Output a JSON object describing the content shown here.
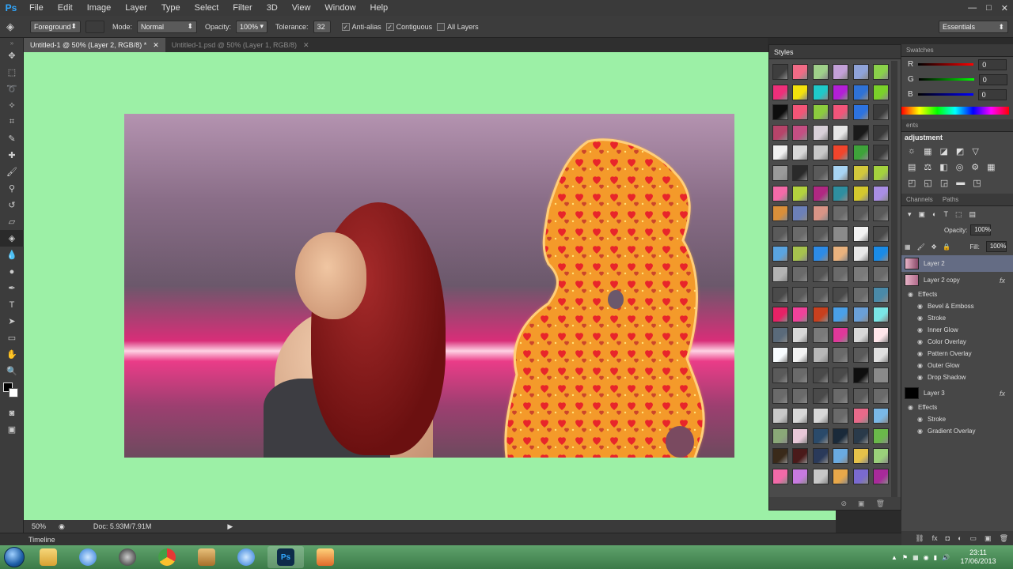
{
  "app": {
    "logo": "Ps"
  },
  "menu": [
    "File",
    "Edit",
    "Image",
    "Layer",
    "Type",
    "Select",
    "Filter",
    "3D",
    "View",
    "Window",
    "Help"
  ],
  "window_controls": {
    "minimize": "—",
    "maximize": "□",
    "close": "✕"
  },
  "options": {
    "fill_source": "Foreground",
    "mode_label": "Mode:",
    "mode_value": "Normal",
    "opacity_label": "Opacity:",
    "opacity_value": "100%",
    "tolerance_label": "Tolerance:",
    "tolerance_value": "32",
    "antialias_label": "Anti-alias",
    "contiguous_label": "Contiguous",
    "all_layers_label": "All Layers",
    "workspace": "Essentials"
  },
  "tabs": [
    {
      "label": "Untitled-1 @ 50% (Layer 2, RGB/8) *",
      "close": "✕"
    },
    {
      "label": "Untitled-1.psd @ 50% (Layer 1, RGB/8)",
      "close": "✕"
    }
  ],
  "status": {
    "zoom": "50%",
    "doc": "Doc: 5.93M/7.91M"
  },
  "timeline": {
    "label": "Timeline"
  },
  "styles_panel": {
    "title": "Styles",
    "swatches": [
      "#3e3e3e",
      "#f16b86",
      "#9fd08a",
      "#c3a0d8",
      "#8fa3d9",
      "#8ad14a",
      "#ee2f7a",
      "#f4e20c",
      "#1fc9c9",
      "#b31fd6",
      "#2f72d6",
      "#7ad12a",
      "#0d0d0d",
      "#f35577",
      "#8ccc3e",
      "#f2557a",
      "#2d73e0",
      "#3c3c3c",
      "#b6446a",
      "#c44f83",
      "#d8d0d8",
      "#e7e7e7",
      "#1a1a1a",
      "#3a3a3a",
      "#f0f0f0",
      "#d8d8d8",
      "#c8c8c8",
      "#f1452c",
      "#3ea33a",
      "#3c3c3c",
      "#9a9a9a",
      "#2a2a2a",
      "#5a5a5a",
      "#a8d4f3",
      "#d2c83c",
      "#a4d23e",
      "#f46aa8",
      "#b3d23e",
      "#b02882",
      "#2f8fa0",
      "#d4c82e",
      "#a98ee4",
      "#d98f3a",
      "#6c80b8",
      "#d89486",
      "#6a6a6a",
      "#5a5a5a",
      "#5a5a5a",
      "#5a5a5a",
      "#6a6a6a",
      "#5a5a5a",
      "#8a8a8a",
      "#f2f2f2",
      "#4a4a4a",
      "#5aa4e0",
      "#a6c24e",
      "#2d8be6",
      "#e9b27e",
      "#e8e8e8",
      "#1a8be6",
      "#b3b3b3",
      "#6a6a6a",
      "#555555",
      "#6a6a6a",
      "#7a7a7a",
      "#6a6a6a",
      "#4a4a4a",
      "#5a5a5a",
      "#5a5a5a",
      "#4a4a4a",
      "#6a6a6a",
      "#4a8aa8",
      "#e62266",
      "#f0429a",
      "#c8401e",
      "#4aa0e8",
      "#6aa0d8",
      "#7ae6e6",
      "#5a6a7a",
      "#d8d8d8",
      "#7a7a7a",
      "#e0389a",
      "#d8d8d8",
      "#ffe6ea",
      "#f8fcff",
      "#f2f2f2",
      "#b8b8b8",
      "#6a6a6a",
      "#5a5a5a",
      "#e0e0e0",
      "#5a5a5a",
      "#6a6a6a",
      "#4a4a4a",
      "#4a4a4a",
      "#0e0e0e",
      "#8a8a8a",
      "#6a6a6a",
      "#6a6a6a",
      "#4a4a4a",
      "#6a6a6a",
      "#5a5a5a",
      "#6a6a6a",
      "#c8c8c8",
      "#d8d8d8",
      "#d8d8d8",
      "#6a6a6a",
      "#e86a8a",
      "#7ab8e6",
      "#8aa878",
      "#e8c8d8",
      "#2a4a6a",
      "#1a2a3a",
      "#2a3a4a",
      "#6ab84a",
      "#3a2a1a",
      "#4a1a1a",
      "#2a3a5a",
      "#6aaae0",
      "#e6c24a",
      "#9ad07a",
      "#f26aa8",
      "#c87ae0",
      "#c8c8c8",
      "#e8a84a",
      "#7a6ad0",
      "#a82a9a"
    ]
  },
  "color_panel": {
    "tab_swatches": "Swatches",
    "r_label": "R",
    "r_value": "0",
    "g_label": "G",
    "g_value": "0",
    "b_label": "B",
    "b_value": "0"
  },
  "adjustments_panel": {
    "tab": "ents",
    "title": "adjustment"
  },
  "layers_panel": {
    "tabs": [
      "Channels",
      "Paths"
    ],
    "opacity_label": "Opacity:",
    "opacity_value": "100%",
    "fill_label": "Fill:",
    "fill_value": "100%",
    "fx_label": "fx",
    "layers": [
      {
        "name": "Layer 2",
        "selected": true,
        "effects_label": "",
        "effects": []
      },
      {
        "name": "Layer 2 copy",
        "selected": false,
        "effects_label": "Effects",
        "effects": [
          "Bevel & Emboss",
          "Stroke",
          "Inner Glow",
          "Color Overlay",
          "Pattern Overlay",
          "Outer Glow",
          "Drop Shadow"
        ]
      },
      {
        "name": "Layer 3",
        "selected": false,
        "effects_label": "Effects",
        "effects": [
          "Stroke",
          "Gradient Overlay"
        ]
      }
    ]
  },
  "taskbar": {
    "apps": [
      "explorer",
      "itunes",
      "media-player",
      "chrome",
      "program",
      "itunes-2",
      "photoshop",
      "paint"
    ],
    "time": "23:11",
    "date": "17/06/2013"
  }
}
